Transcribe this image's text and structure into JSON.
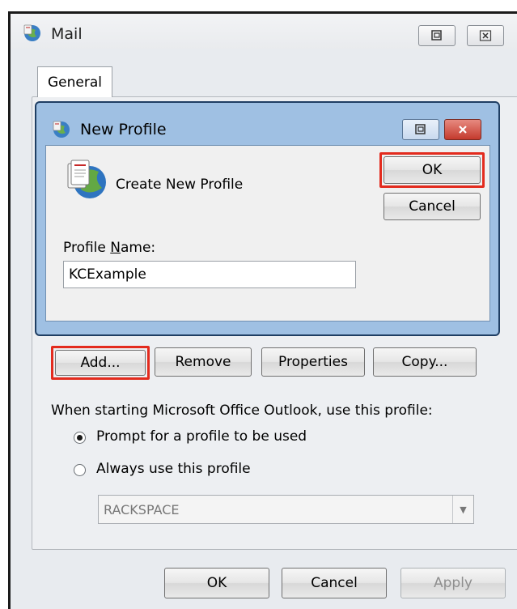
{
  "mail_window": {
    "title": "Mail",
    "icons": {
      "app": "mail-app-icon",
      "restore": "restore-icon",
      "close": "close-icon"
    }
  },
  "tabs": [
    {
      "label": "General"
    }
  ],
  "new_profile_dialog": {
    "title": "New Profile",
    "heading": "Create New Profile",
    "ok_label": "OK",
    "cancel_label": "Cancel",
    "profile_name_label_prefix": "Profile ",
    "profile_name_label_access": "N",
    "profile_name_label_suffix": "ame:",
    "profile_name_value": "KCExample",
    "icons": {
      "heading": "profile-globe-icon"
    }
  },
  "profile_buttons": {
    "add": "Add...",
    "remove": "Remove",
    "properties": "Properties",
    "copy": "Copy..."
  },
  "startup": {
    "instruction": "When starting Microsoft Office Outlook, use this profile:",
    "prompt_option": "Prompt for a profile to be used",
    "always_option": "Always use this profile",
    "selected_option": "prompt",
    "profile_select_value": "RACKSPACE"
  },
  "footer": {
    "ok": "OK",
    "cancel": "Cancel",
    "apply": "Apply"
  },
  "colors": {
    "highlight": "#e32b1e",
    "dialog_frame": "#9fc0e3",
    "close_button_red": "#d0473a"
  }
}
